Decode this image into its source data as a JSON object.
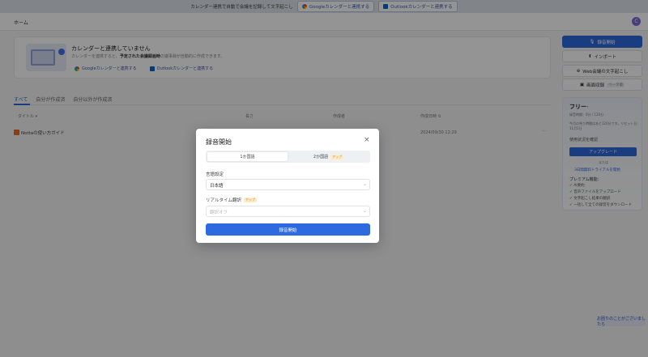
{
  "banner": {
    "message": "カレンダー連携で自動で会議を記録して文字起こし",
    "google_link": "Googleカレンダーと連携する",
    "outlook_link": "Outlookカレンダーと連携する"
  },
  "header": {
    "breadcrumb": "ホーム",
    "avatar_letter": "C"
  },
  "calendar_card": {
    "title": "カレンダーと連携していません",
    "desc_before": "カレンダーを連携すると、",
    "desc_bold": "予定された会議録画時",
    "desc_after": "の議事録が自動的に作成できます。",
    "google_link": "Googleカレンダーと連携する",
    "outlook_link": "Outlookカレンダーと連携する"
  },
  "tabs": [
    {
      "label": "すべて",
      "active": true
    },
    {
      "label": "自分が作成済"
    },
    {
      "label": "自分以外が作成済"
    }
  ],
  "table": {
    "columns": [
      "タイトル ▾",
      "長さ",
      "作成者",
      "作成日時 ⇅"
    ],
    "rows": [
      {
        "title": "Nottaの使い方ガイド",
        "date": "2024/09/30 12:29",
        "more": "···"
      }
    ]
  },
  "sidebar": {
    "record_button": "録音開始",
    "import_button": "インポート",
    "web_button": "Web会議の文字起こし",
    "screen_button": "画面収録",
    "screen_tag": "ベータ版",
    "plan": {
      "name": "フリー",
      "badge": "→",
      "line1": "録音時間：0分 / 120分",
      "line2": "今月の残り時間はあと120分です。リセット日：",
      "line3": "11月1日",
      "check_usage": "使用状況を確認",
      "upgrade": "アップグレード",
      "or": "または",
      "trial": "3日間無料トライアルを開始",
      "features_title": "プレミアム機能：",
      "features": [
        "✓ AI要約",
        "✓ 音声ファイルをアップロード",
        "✓ 文字起こし結果の翻訳",
        "✓ 一括して全ての録音をダウンロード"
      ]
    },
    "help": "お困りのことがございましたら"
  },
  "modal": {
    "title": "録音開始",
    "close": "×",
    "mode_1": "1か国語",
    "mode_2": "2か国語",
    "mode_2_badge": "アップ",
    "lang_label": "言語設定",
    "lang_value": "日本語",
    "rt_label": "リアルタイム翻訳",
    "rt_badge": "アップ",
    "rt_value": "翻訳オフ",
    "start": "録音開始"
  },
  "colors": {
    "accent": "#2d6ae0",
    "overlay": "rgba(0,0,0,0.42)",
    "badge_bg": "#fdebc8",
    "badge_text": "#d08a12"
  }
}
